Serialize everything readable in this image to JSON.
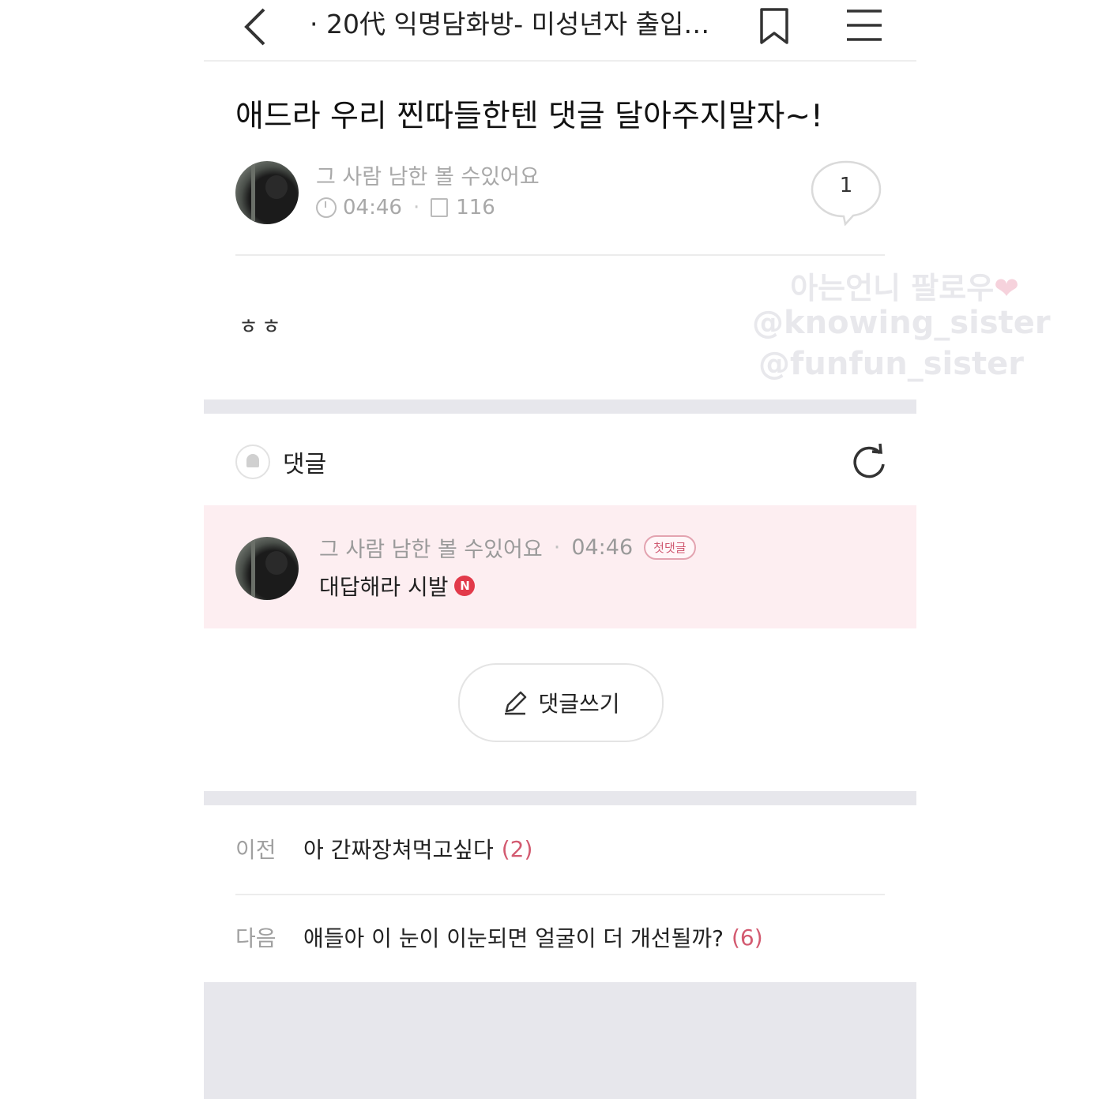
{
  "header": {
    "title": "· 20代 익명담화방- 미성년자 출입…"
  },
  "post": {
    "title": "애드라 우리 찐따들한텐 댓글 달아주지말자~!",
    "author": "그 사람 남한 볼 수있어요",
    "time": "04:46",
    "views": "116",
    "comment_count": "1",
    "body": "ㅎㅎ"
  },
  "watermark": {
    "line1": "아는언니 팔로우",
    "heart": "❤",
    "line2": "@knowing_sister",
    "line3": "@funfun_sister"
  },
  "comments": {
    "label": "댓글",
    "items": [
      {
        "author": "그 사람 남한 볼 수있어요",
        "time": "04:46",
        "badge": "첫댓글",
        "text": "대답해라 시발",
        "new_mark": "N"
      }
    ],
    "write_label": "댓글쓰기"
  },
  "navigation": {
    "prev": {
      "key": "이전",
      "title": "아 간짜장쳐먹고싶다",
      "count": "(2)"
    },
    "next": {
      "key": "다음",
      "title": "애들아 이 눈이 이눈되면 얼굴이 더 개선될까?",
      "count": "(6)"
    }
  },
  "colors": {
    "accent": "#d35a70",
    "comment_highlight": "#fdeef1",
    "band": "#e7e7ec"
  },
  "icons": [
    "back-arrow-icon",
    "bookmark-icon",
    "hamburger-menu-icon",
    "clock-icon",
    "document-icon",
    "speech-bubble-icon",
    "bell-icon",
    "refresh-icon",
    "pencil-icon"
  ]
}
